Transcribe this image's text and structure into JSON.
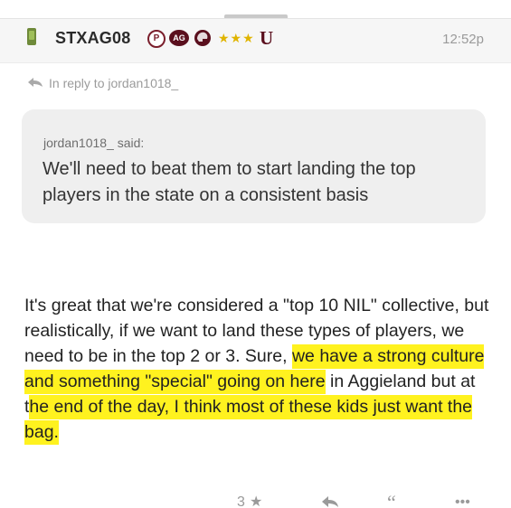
{
  "post": {
    "username": "STXAG08",
    "badges": {
      "p": "P",
      "ag": "AG",
      "stars": "★★★",
      "u": "U"
    },
    "timestamp": "12:52p",
    "reply_to": "In reply to jordan1018_",
    "quote": {
      "author": "jordan1018_ said:",
      "text": "We'll need to beat them to start landing the top players in the state on a consistent basis"
    },
    "body": [
      {
        "text": "It's great that we're considered a \"top 10 NIL\" collective, but realistically, if we want to land these types of players, we need to be in the top 2 or 3. Sure, ",
        "highlight": false
      },
      {
        "text": "we have a strong culture and something \"special\" going on here",
        "highlight": true
      },
      {
        "text": " in Aggieland but at t",
        "highlight": false
      },
      {
        "text": "he end of the day, I think most of these kids just want the bag.",
        "highlight": true
      }
    ],
    "actions": {
      "likes": "3",
      "like_icon": "star-icon",
      "reply_icon": "reply-arrow-icon",
      "quote_icon": "quote-icon",
      "more_icon": "more-icon"
    }
  },
  "colors": {
    "highlight": "#fff21f",
    "maroon": "#5a0f1d",
    "star_gold": "#e0b400"
  }
}
